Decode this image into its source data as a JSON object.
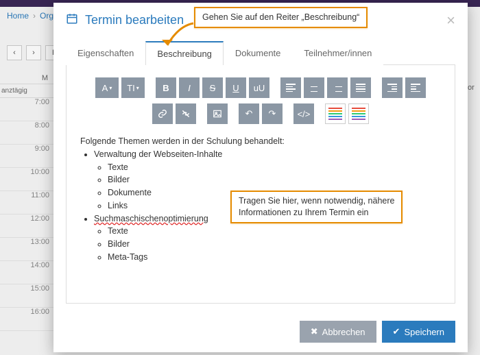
{
  "breadcrumbs": {
    "home": "Home",
    "item2": "Organ"
  },
  "bg": {
    "dayhdr": "M",
    "allday": "anztägig",
    "hours": [
      "7:00",
      "8:00",
      "9:00",
      "10:00",
      "11:00",
      "12:00",
      "13:00",
      "14:00",
      "15:00",
      "16:00"
    ],
    "rightcol": "or",
    "navH": "H"
  },
  "modal": {
    "title": "Termin bearbeiten",
    "tabs": {
      "props": "Eigenschaften",
      "desc": "Beschreibung",
      "docs": "Dokumente",
      "part": "Teilnehmer/innen"
    },
    "toolbar": {
      "a": "A",
      "ti": "TI",
      "b": "B",
      "i": "I",
      "s": "S",
      "u": "U",
      "uu": "uU"
    },
    "editor": {
      "intro": "Folgende Themen werden in der Schulung behandelt:",
      "i1": "Verwaltung der Webseiten-Inhalte",
      "i1a": "Texte",
      "i1b": "Bilder",
      "i1c": "Dokumente",
      "i1d": "Links",
      "i2": "Suchmaschischenoptimierung",
      "i2a": "Texte",
      "i2b": "Bilder",
      "i2c": "Meta-Tags"
    },
    "cancel": "Abbrechen",
    "save": "Speichern"
  },
  "callouts": {
    "top": "Gehen Sie auf den Reiter „Beschreibung“",
    "mid1": "Tragen Sie hier, wenn notwendig, nähere",
    "mid2": "Informationen zu Ihrem Termin ein"
  }
}
